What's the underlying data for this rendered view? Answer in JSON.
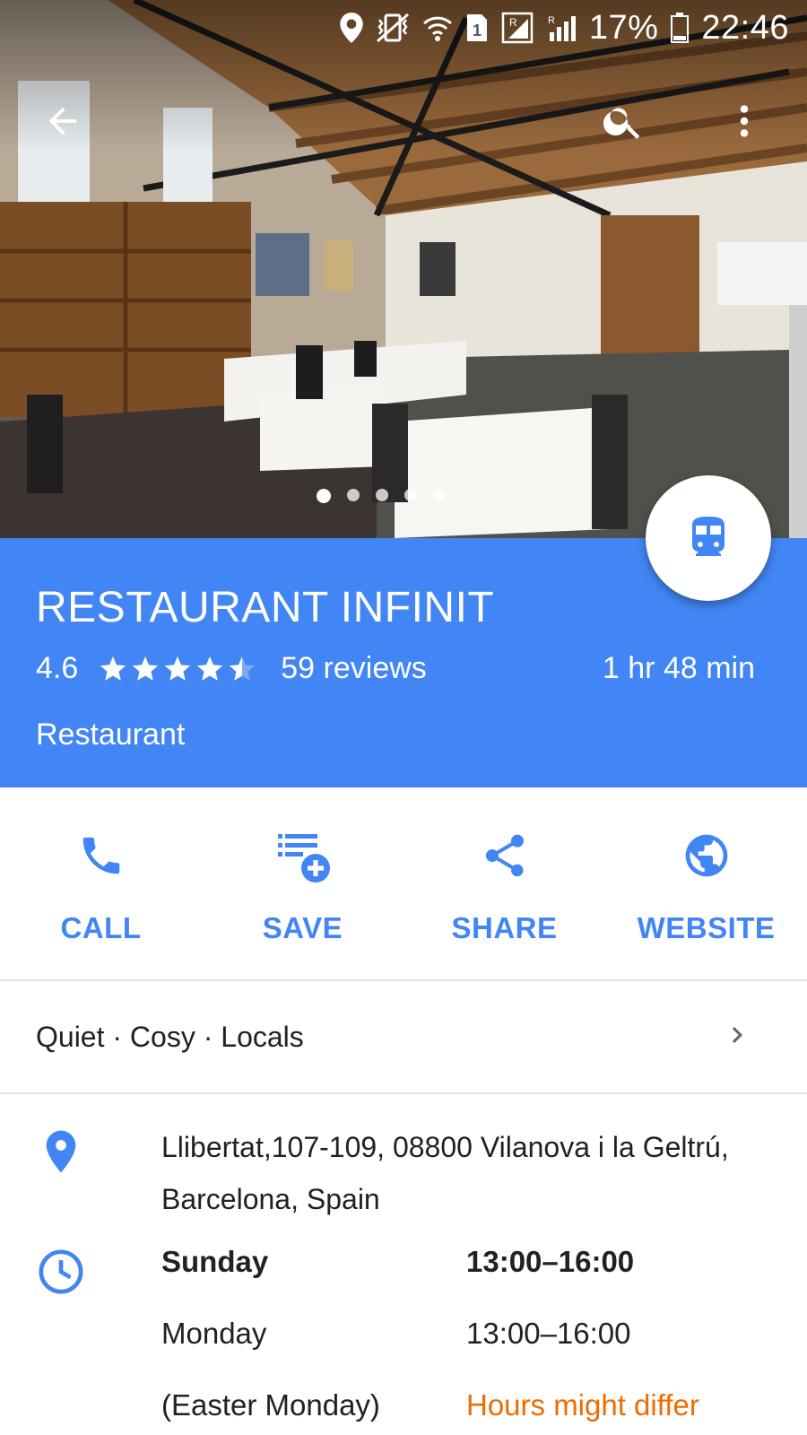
{
  "status_bar": {
    "battery": "17%",
    "time": "22:46",
    "icons": [
      "location-icon",
      "vibrate-icon",
      "wifi-icon",
      "sim1-icon",
      "signal-r-icon",
      "signal-icon",
      "battery-icon"
    ]
  },
  "app_bar": {
    "icons": [
      "back-arrow-icon",
      "search-icon",
      "more-vert-icon"
    ]
  },
  "photo_carousel": {
    "count": 5,
    "active_index": 0
  },
  "place": {
    "name": "RESTAURANT INFINIT",
    "rating": "4.6",
    "rating_value": 4.6,
    "reviews": "59 reviews",
    "travel_time": "1 hr 48 min",
    "category": "Restaurant",
    "directions_icon": "train-icon"
  },
  "actions": [
    {
      "label": "CALL",
      "icon": "phone-icon"
    },
    {
      "label": "SAVE",
      "icon": "playlist-add-icon"
    },
    {
      "label": "SHARE",
      "icon": "share-icon"
    },
    {
      "label": "WEBSITE",
      "icon": "globe-icon"
    }
  ],
  "highlights": {
    "text": "Quiet · Cosy · Locals"
  },
  "address": {
    "line1": "Llibertat,107-109, 08800 Vilanova i la Geltrú,",
    "line2": "Barcelona, Spain"
  },
  "hours": [
    {
      "day": "Sunday",
      "time": "13:00–16:00",
      "current": true
    },
    {
      "day": "Monday",
      "time": "13:00–16:00"
    },
    {
      "day": "(Easter Monday)",
      "note": "Hours might differ"
    }
  ],
  "colors": {
    "accent": "#4285f4",
    "warning": "#ef6c00",
    "text": "#212121"
  }
}
